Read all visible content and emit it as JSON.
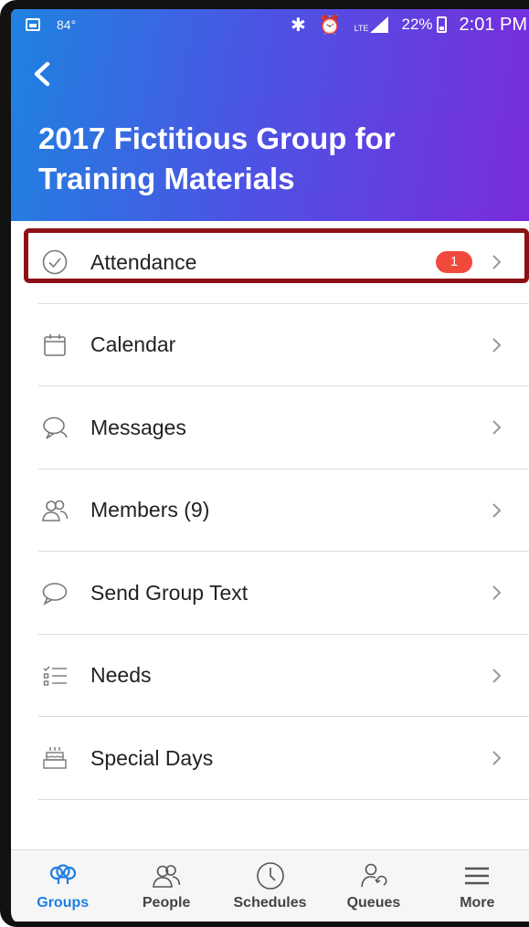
{
  "status_bar": {
    "temperature": "84°",
    "battery_percent": "22%",
    "time": "2:01 PM",
    "network": "LTE"
  },
  "header": {
    "back_icon": "chevron-left-icon",
    "title": "2017 Fictitious Group for Training Materials"
  },
  "menu": [
    {
      "key": "attendance",
      "label": "Attendance",
      "icon": "check-circle-icon",
      "badge": "1"
    },
    {
      "key": "calendar",
      "label": "Calendar",
      "icon": "calendar-icon"
    },
    {
      "key": "messages",
      "label": "Messages",
      "icon": "chat-bubbles-icon"
    },
    {
      "key": "members",
      "label": "Members (9)",
      "icon": "people-icon"
    },
    {
      "key": "send-group-text",
      "label": "Send Group Text",
      "icon": "speech-bubble-icon"
    },
    {
      "key": "needs",
      "label": "Needs",
      "icon": "checklist-icon"
    },
    {
      "key": "special-days",
      "label": "Special Days",
      "icon": "birthday-cake-icon"
    }
  ],
  "tabs": [
    {
      "key": "groups",
      "label": "Groups",
      "icon": "groups-icon",
      "active": true
    },
    {
      "key": "people",
      "label": "People",
      "icon": "people-icon"
    },
    {
      "key": "schedules",
      "label": "Schedules",
      "icon": "clock-icon"
    },
    {
      "key": "queues",
      "label": "Queues",
      "icon": "person-refresh-icon"
    },
    {
      "key": "more",
      "label": "More",
      "icon": "hamburger-menu-icon"
    }
  ],
  "colors": {
    "header_gradient_start": "#1e83e0",
    "header_gradient_end": "#7a2bdc",
    "badge": "#ef4a3c",
    "highlight_border": "#8d1114",
    "active_tab": "#1e7fe0"
  }
}
